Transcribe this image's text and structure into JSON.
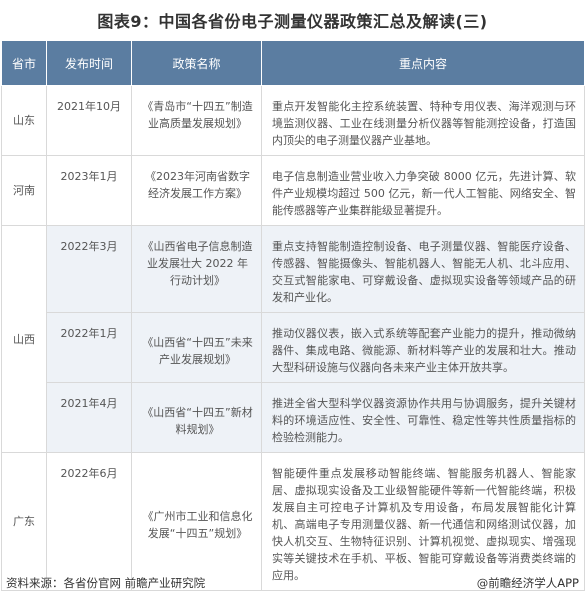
{
  "title": "图表9：中国各省份电子测量仪器政策汇总及解读(三)",
  "headers": [
    "省市",
    "发布时间",
    "政策名称",
    "重点内容"
  ],
  "rows": [
    {
      "province": "山东",
      "date": "2021年10月",
      "policy": "《青岛市“十四五”制造业高质量发展规划》",
      "content": "重点开发智能化主控系统装置、特种专用仪表、海洋观测与环境监测仪器、工业在线测量分析仪器等智能测控设备，打造国内顶尖的电子测量仪器产业基地。"
    },
    {
      "province": "河南",
      "date": "2023年1月",
      "policy": "《2023年河南省数字经济发展工作方案》",
      "content": "电子信息制造业营业收入力争突破 8000 亿元，先进计算、软件产业规模均超过 500 亿元，新一代人工智能、网络安全、智能传感器等产业集群能级显著提升。"
    },
    {
      "province": "山西",
      "date": "2022年3月",
      "policy": "《山西省电子信息制造业发展壮大 2022 年行动计划》",
      "content": "重点支持智能制造控制设备、电子测量仪器、智能医疗设备、传感器、智能摄像头、智能机器人、智能无人机、北斗应用、交互式智能家电、可穿戴设备、虚拟现实设备等领域产品的研发和产业化。"
    },
    {
      "province": "",
      "date": "2022年1月",
      "policy": "《山西省“十四五”未来产业发展规划》",
      "content": "推动仪器仪表，嵌入式系统等配套产业能力的提升，推动微纳器件、集成电路、微能源、新材料等产业的发展和壮大。推动大型科研设施与仪器向各未来产业主体开放共享。"
    },
    {
      "province": "",
      "date": "2021年4月",
      "policy": "《山西省“十四五”新材料规划》",
      "content": "推进全省大型科学仪器资源协作共用与协调服务，提升关键材料的环境适应性、安全性、可靠性、稳定性等共性质量指标的检验检测能力。"
    },
    {
      "province": "广东",
      "date": "2022年6月",
      "policy": "《广州市工业和信息化发展“十四五”规划》",
      "content": "智能硬件重点发展移动智能终端、智能服务机器人、智能家居、虚拟现实设备及工业级智能硬件等新一代智能终端，积极发展自主可控电子计算机及专用设备，布局发展智能化计算机、高端电子专用测量仪器、新一代通信和网络测试仪器，加快人机交互、生物特征识别、计算机视觉、虚拟现实、增强现实等关键技术在手机、平板、智能可穿戴设备等消费类终端的应用。"
    }
  ],
  "source": "资料来源：各省份官网 前瞻产业研究院",
  "brand": "@前瞻经济学人APP"
}
